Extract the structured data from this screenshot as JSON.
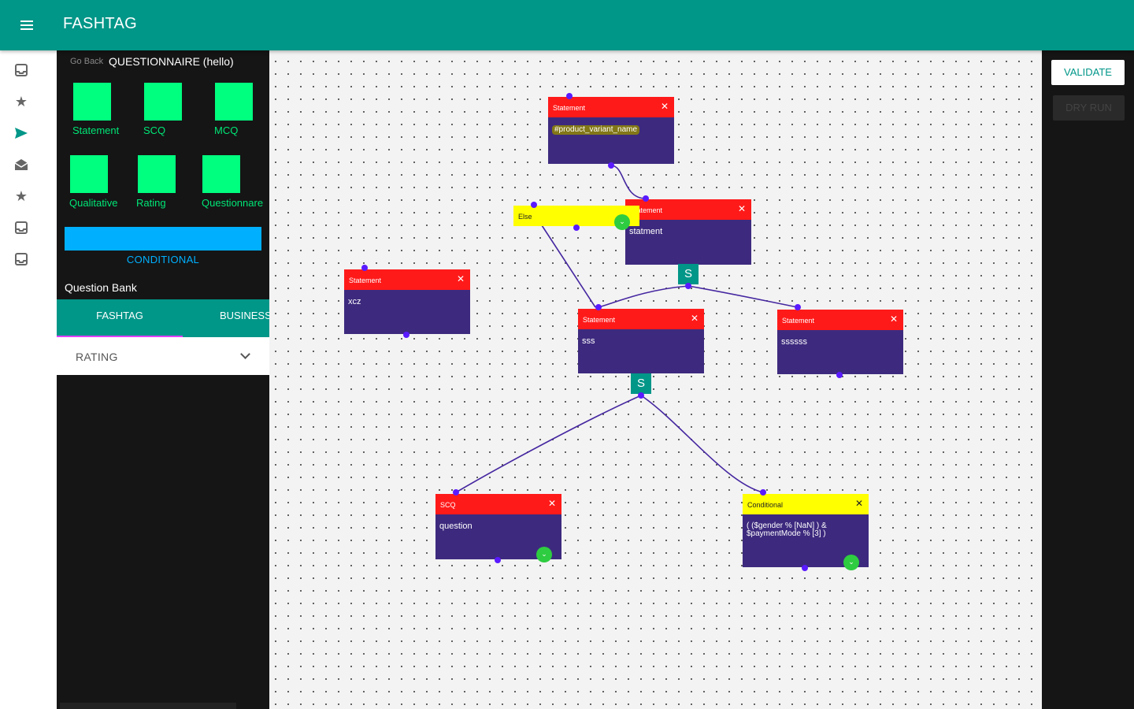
{
  "app": {
    "title": "FASHTAG"
  },
  "rail": {
    "icons": [
      "inbox-icon",
      "star-icon",
      "send-icon",
      "drafts-icon",
      "star-icon",
      "inbox-icon",
      "inbox-icon"
    ]
  },
  "panel": {
    "go_back": "Go Back",
    "title": "QUESTIONNAIRE (hello)",
    "tiles": [
      "Statement",
      "SCQ",
      "MCQ",
      "Qualitative",
      "Rating",
      "Questionnare"
    ],
    "conditional_label": "CONDITIONAL",
    "question_bank": "Question Bank",
    "tabs": [
      "FASHTAG",
      "BUSINESS"
    ],
    "dropdown": "RATING"
  },
  "nodes": [
    {
      "type": "Statement",
      "text": "#product_variant_name"
    },
    {
      "type": "Statement",
      "text": "statment"
    },
    {
      "type": "Else",
      "text": ""
    },
    {
      "type": "Statement",
      "text": "xcz"
    },
    {
      "type": "Statement",
      "text": "sss"
    },
    {
      "type": "Statement",
      "text": "ssssss"
    },
    {
      "type": "SCQ",
      "text": "question"
    },
    {
      "type": "Conditional",
      "text": "( ($gender % [NaN] ) & $paymentMode % [3] )"
    }
  ],
  "badges": [
    "S",
    "S"
  ],
  "actions": {
    "validate": "VALIDATE",
    "dry_run": "DRY RUN"
  },
  "colors": {
    "appbar": "#009688",
    "node_body": "#3d2a7e",
    "node_header": "#ff1a1a",
    "tile": "#00ff7f",
    "conditional": "#00b0ff"
  }
}
